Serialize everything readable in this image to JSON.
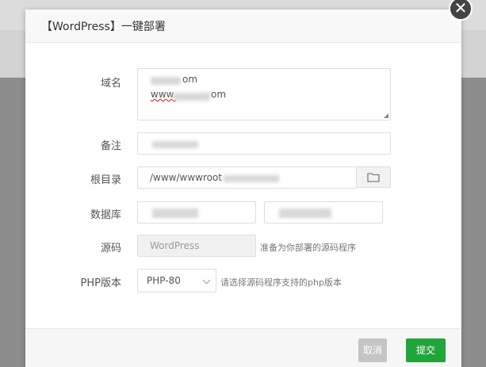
{
  "dialog": {
    "title": "【WordPress】一键部署",
    "close_glyph": "✕"
  },
  "form": {
    "domain": {
      "label": "域名",
      "line1_suffix": "om",
      "line2_prefix": "www.",
      "line2_suffix": "om"
    },
    "remark": {
      "label": "备注"
    },
    "root": {
      "label": "根目录",
      "value": "/www/wwwroot"
    },
    "database": {
      "label": "数据库"
    },
    "source": {
      "label": "源码",
      "value": "WordPress",
      "hint": "准备为你部署的源码程序"
    },
    "php": {
      "label": "PHP版本",
      "selected": "PHP-80",
      "hint": "请选择源码程序支持的php版本"
    }
  },
  "footer": {
    "cancel_label": "取消",
    "submit_label": "提交"
  },
  "colors": {
    "submit": "#20a53a",
    "cancel": "#c5c5c5",
    "close": "#444444"
  }
}
